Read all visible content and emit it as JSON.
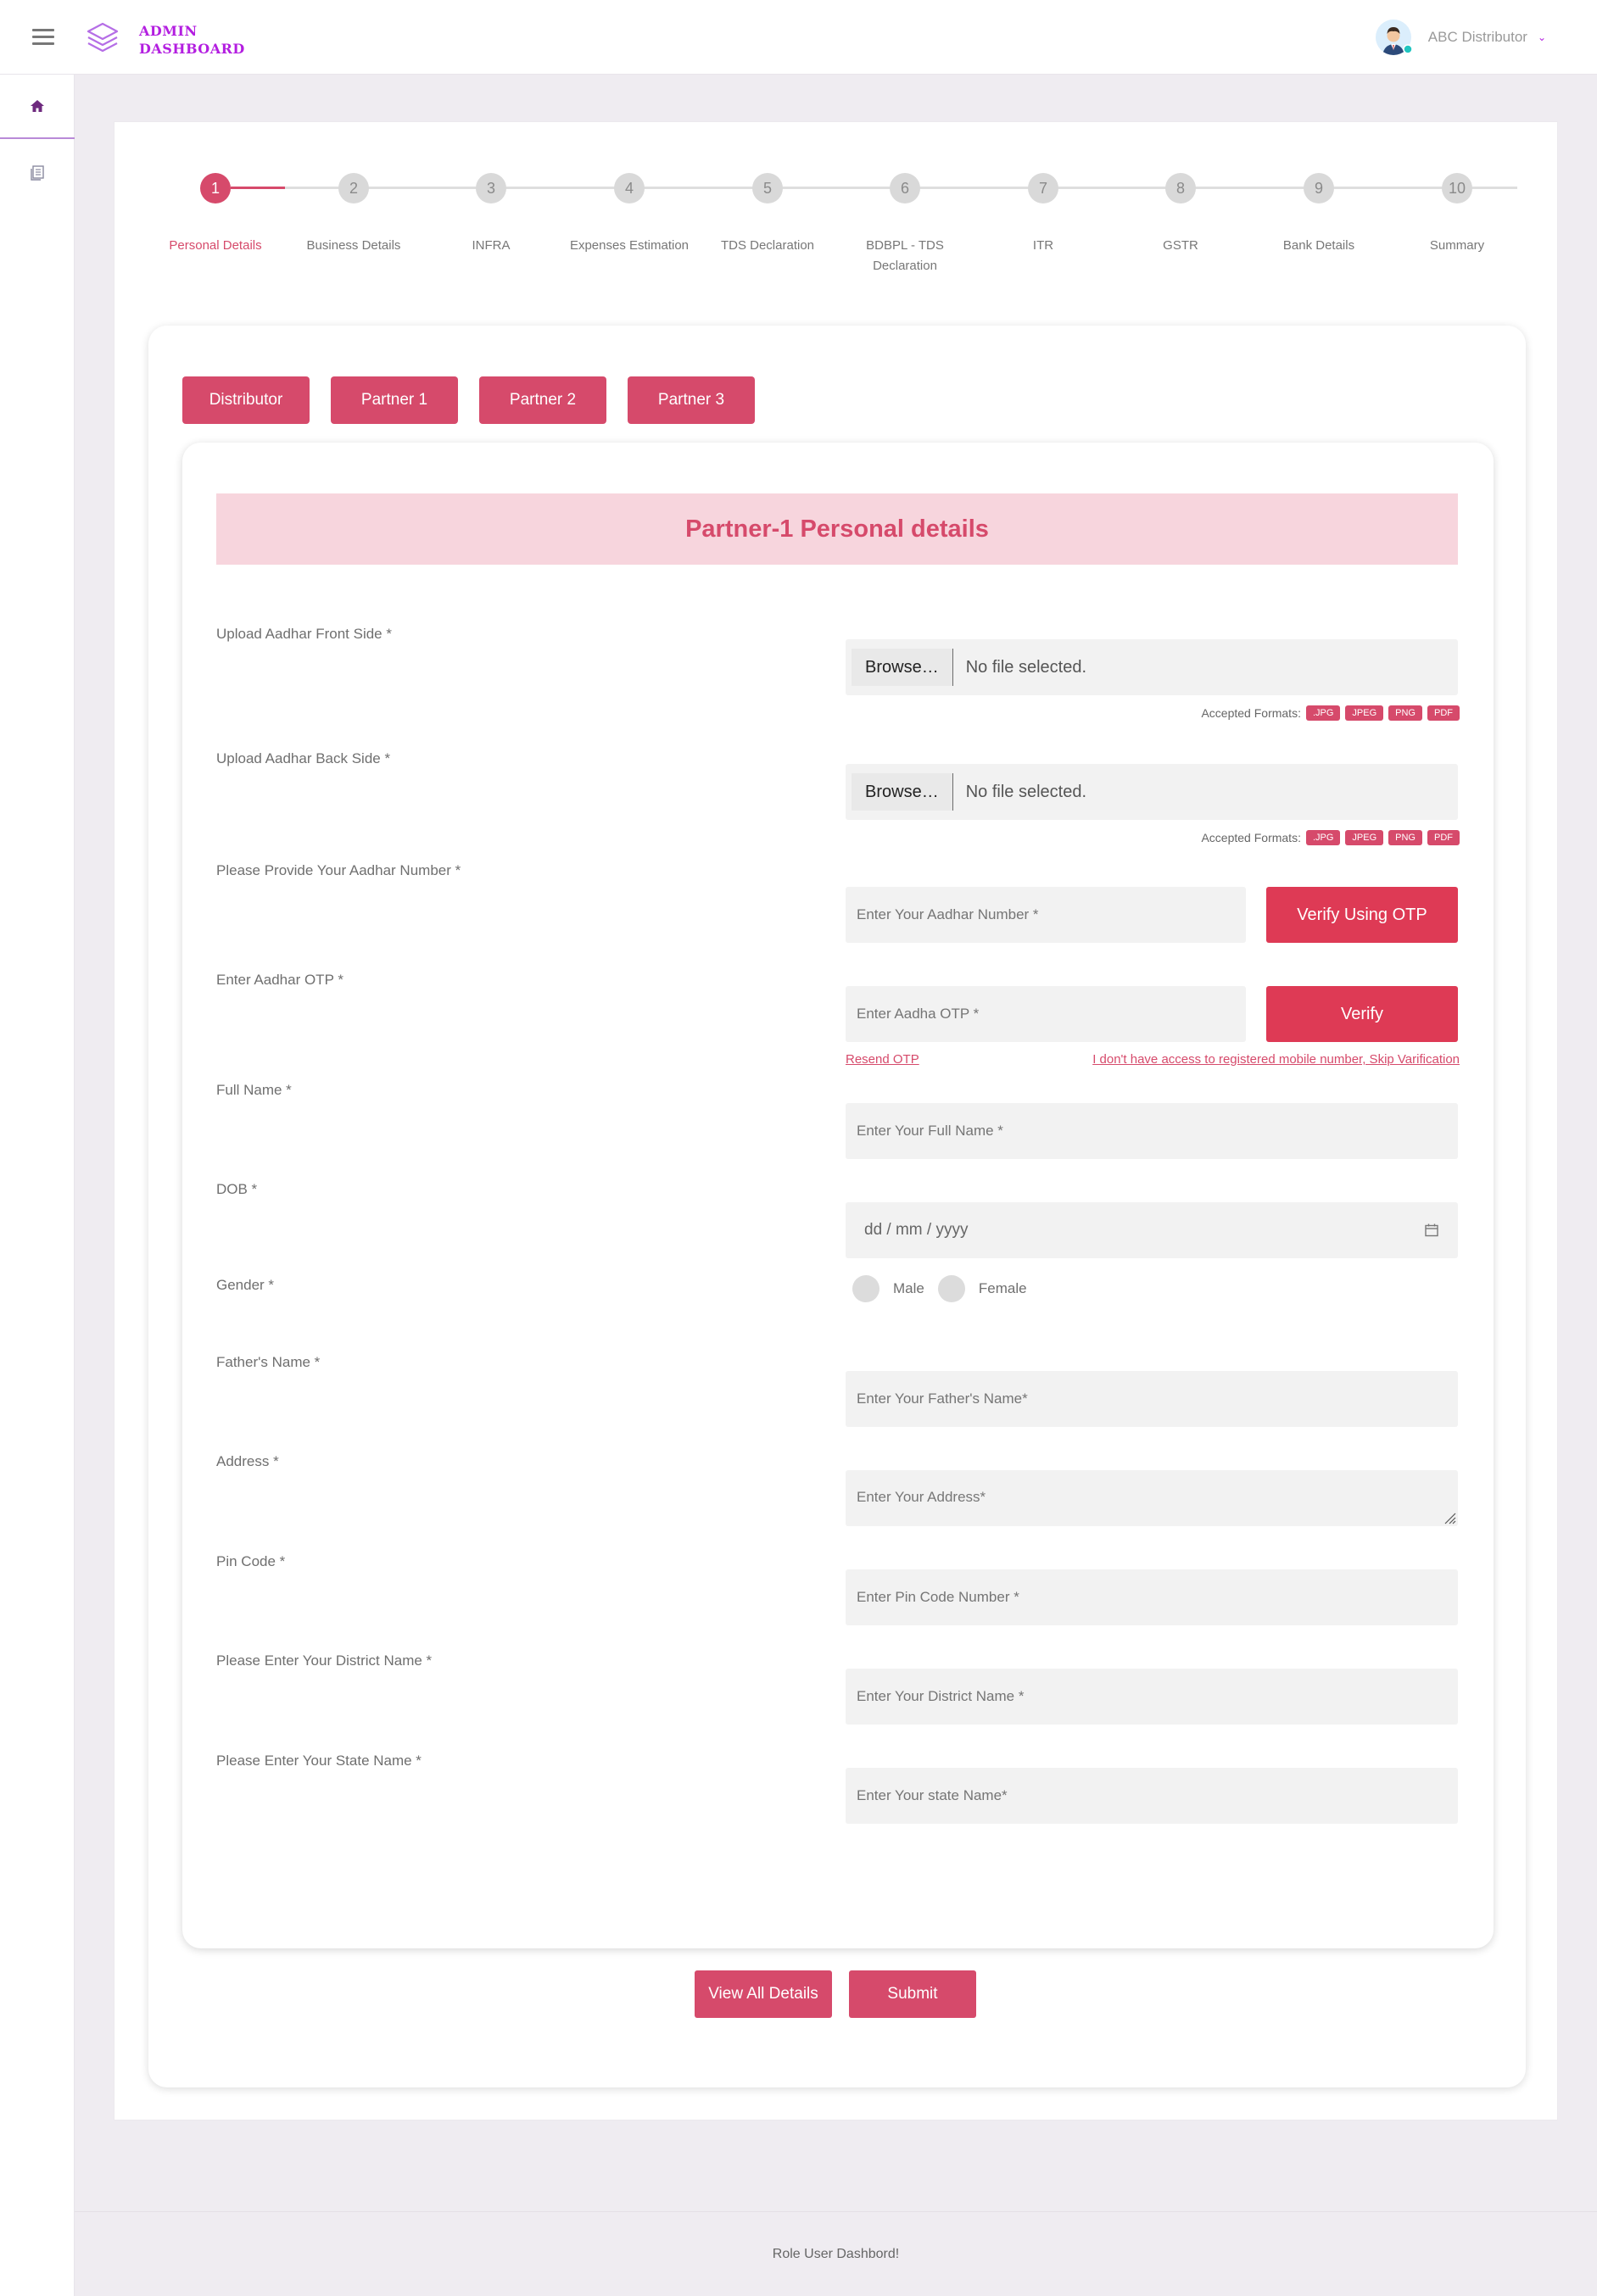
{
  "header": {
    "logo_line1": "ADMIN",
    "logo_line2": "DASHBOARD",
    "user_name": "ABC Distributor"
  },
  "sidebar": {
    "items": [
      {
        "icon": "home-icon"
      },
      {
        "icon": "document-list-icon"
      }
    ]
  },
  "stepper": {
    "steps": [
      {
        "num": "1",
        "label": "Personal Details"
      },
      {
        "num": "2",
        "label": "Business Details"
      },
      {
        "num": "3",
        "label": "INFRA"
      },
      {
        "num": "4",
        "label": "Expenses Estimation"
      },
      {
        "num": "5",
        "label": "TDS Declaration"
      },
      {
        "num": "6",
        "label": "BDBPL - TDS Declaration"
      },
      {
        "num": "7",
        "label": "ITR"
      },
      {
        "num": "8",
        "label": "GSTR"
      },
      {
        "num": "9",
        "label": "Bank Details"
      },
      {
        "num": "10",
        "label": "Summary"
      }
    ],
    "active_step": 1
  },
  "tabs": [
    "Distributor",
    "Partner 1",
    "Partner 2",
    "Partner 3"
  ],
  "form": {
    "title": "Partner-1 Personal details",
    "aadhar_front_label": "Upload Aadhar Front Side *",
    "aadhar_back_label": "Upload Aadhar Back Side *",
    "browse_label": "Browse…",
    "no_file_text": "No file selected.",
    "accepted_formats_label": "Accepted Formats:",
    "formats": [
      ".JPG",
      "JPEG",
      "PNG",
      "PDF"
    ],
    "aadhar_number_label": "Please Provide Your Aadhar Number *",
    "aadhar_number_placeholder": "Enter Your Aadhar Number *",
    "verify_otp_button": "Verify Using OTP",
    "aadhar_otp_label": "Enter Aadhar OTP *",
    "aadhar_otp_placeholder": "Enter Aadha OTP *",
    "verify_button": "Verify",
    "resend_otp_link": "Resend OTP",
    "skip_verification_link": "I don't have access to registered mobile number, Skip Varification",
    "full_name_label": "Full Name *",
    "full_name_placeholder": "Enter Your Full Name *",
    "dob_label": "DOB *",
    "dob_placeholder": "dd / mm / yyyy",
    "gender_label": "Gender *",
    "gender_options": [
      "Male",
      "Female"
    ],
    "father_name_label": "Father's Name *",
    "father_name_placeholder": "Enter Your Father's Name*",
    "address_label": "Address *",
    "address_placeholder": "Enter Your Address*",
    "pin_code_label": "Pin Code *",
    "pin_code_placeholder": "Enter Pin Code Number *",
    "district_label": "Please Enter Your District Name *",
    "district_placeholder": "Enter Your District Name *",
    "state_label": "Please Enter Your State Name *",
    "state_placeholder": "Enter Your state Name*"
  },
  "actions": {
    "view_all": "View All Details",
    "submit": "Submit"
  },
  "footer": {
    "text": "Role User Dashbord!"
  },
  "colors": {
    "accent": "#d64a6b",
    "verify_red": "#de3a55",
    "section_bg": "#f7d5dd",
    "logo_purple": "#b31ee0"
  }
}
